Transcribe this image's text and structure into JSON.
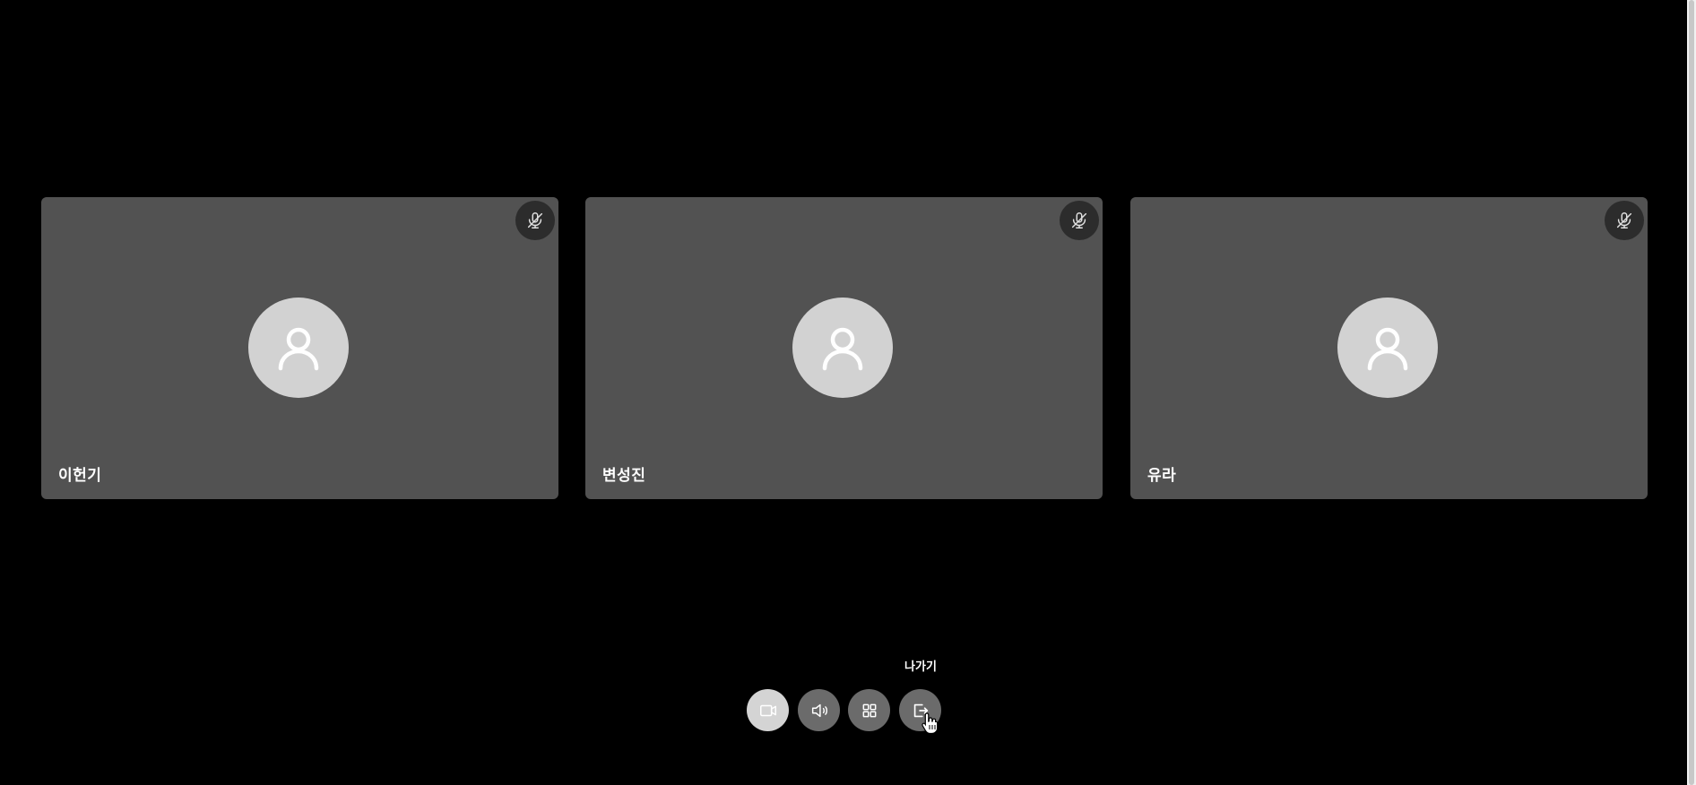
{
  "participants": [
    {
      "name": "이헌기",
      "avatar_icon": "user-icon",
      "mic_icon": "mic-off-icon"
    },
    {
      "name": "변성진",
      "avatar_icon": "user-icon",
      "mic_icon": "mic-off-icon"
    },
    {
      "name": "유라",
      "avatar_icon": "user-icon",
      "mic_icon": "mic-off-icon"
    }
  ],
  "controls": {
    "camera": {
      "icon": "video-camera-icon"
    },
    "speaker": {
      "icon": "speaker-icon"
    },
    "layout": {
      "icon": "grid-icon"
    },
    "leave": {
      "icon": "exit-icon",
      "tooltip": "나가기"
    }
  },
  "colors": {
    "background": "#000000",
    "tile": "#525252",
    "avatar": "#d2d2d2",
    "mute_badge": "#2c2c2c",
    "control_button": "#6b6b6b",
    "camera_button_active": "#d4d4d4"
  }
}
